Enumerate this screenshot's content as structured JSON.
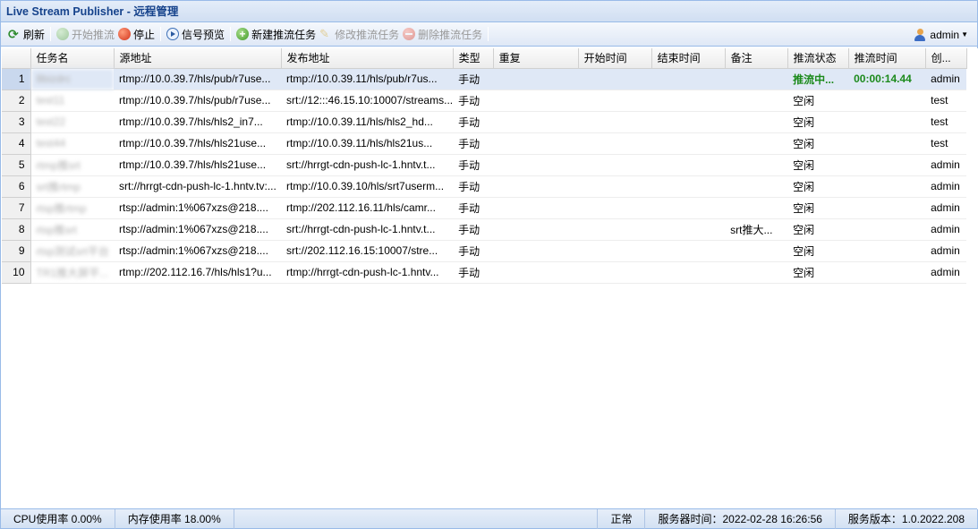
{
  "window": {
    "title": "Live Stream Publisher - 远程管理"
  },
  "toolbar": {
    "refresh": "刷新",
    "start": "开始推流",
    "stop": "停止",
    "preview": "信号预览",
    "new_task": "新建推流任务",
    "edit_task": "修改推流任务",
    "delete_task": "删除推流任务",
    "user": "admin"
  },
  "table": {
    "columns": [
      "",
      "任务名",
      "源地址",
      "发布地址",
      "类型",
      "重复",
      "开始时间",
      "结束时间",
      "备注",
      "推流状态",
      "推流时间",
      "创..."
    ],
    "rows": [
      {
        "num": "1",
        "name": "8bizdrc",
        "src": "rtmp://10.0.39.7/hls/pub/r7use...",
        "dst": "rtmp://10.0.39.11/hls/pub/r7us...",
        "type": "手动",
        "repeat": "",
        "start": "",
        "end": "",
        "note": "",
        "status": "推流中...",
        "time": "00:00:14.44",
        "creator": "admin"
      },
      {
        "num": "2",
        "name": "test11",
        "src": "rtmp://10.0.39.7/hls/pub/r7use...",
        "dst": "srt://12:::46.15.10:10007/streams...",
        "type": "手动",
        "repeat": "",
        "start": "",
        "end": "",
        "note": "",
        "status": "空闲",
        "time": "",
        "creator": "test"
      },
      {
        "num": "3",
        "name": "test22",
        "src": "rtmp://10.0.39.7/hls/hls2_in7...",
        "dst": "rtmp://10.0.39.11/hls/hls2_hd...",
        "type": "手动",
        "repeat": "",
        "start": "",
        "end": "",
        "note": "",
        "status": "空闲",
        "time": "",
        "creator": "test"
      },
      {
        "num": "4",
        "name": "test44",
        "src": "rtmp://10.0.39.7/hls/hls21use...",
        "dst": "rtmp://10.0.39.11/hls/hls21us...",
        "type": "手动",
        "repeat": "",
        "start": "",
        "end": "",
        "note": "",
        "status": "空闲",
        "time": "",
        "creator": "test"
      },
      {
        "num": "5",
        "name": "rtmp推srt",
        "src": "rtmp://10.0.39.7/hls/hls21use...",
        "dst": "srt://hrrgt-cdn-push-lc-1.hntv.t...",
        "type": "手动",
        "repeat": "",
        "start": "",
        "end": "",
        "note": "",
        "status": "空闲",
        "time": "",
        "creator": "admin"
      },
      {
        "num": "6",
        "name": "srt推rtmp",
        "src": "srt://hrrgt-cdn-push-lc-1.hntv.tv:...",
        "dst": "rtmp://10.0.39.10/hls/srt7userm...",
        "type": "手动",
        "repeat": "",
        "start": "",
        "end": "",
        "note": "",
        "status": "空闲",
        "time": "",
        "creator": "admin"
      },
      {
        "num": "7",
        "name": "rtsp推rtmp",
        "src": "rtsp://admin:1%067xzs@218....",
        "dst": "rtmp://202.112.16.11/hls/camr...",
        "type": "手动",
        "repeat": "",
        "start": "",
        "end": "",
        "note": "",
        "status": "空闲",
        "time": "",
        "creator": "admin"
      },
      {
        "num": "8",
        "name": "rtsp推srt",
        "src": "rtsp://admin:1%067xzs@218....",
        "dst": "srt://hrrgt-cdn-push-lc-1.hntv.t...",
        "type": "手动",
        "repeat": "",
        "start": "",
        "end": "",
        "note": "srt推大...",
        "status": "空闲",
        "time": "",
        "creator": "admin"
      },
      {
        "num": "9",
        "name": "rtsp测试srt平台",
        "src": "rtsp://admin:1%067xzs@218....",
        "dst": "srt://202.112.16.15:10007/stre...",
        "type": "手动",
        "repeat": "",
        "start": "",
        "end": "",
        "note": "",
        "status": "空闲",
        "time": "",
        "creator": "admin"
      },
      {
        "num": "10",
        "name": "TR1推大屏平...",
        "src": "rtmp://202.112.16.7/hls/hls1?u...",
        "dst": "rtmp://hrrgt-cdn-push-lc-1.hntv...",
        "type": "手动",
        "repeat": "",
        "start": "",
        "end": "",
        "note": "",
        "status": "空闲",
        "time": "",
        "creator": "admin"
      }
    ]
  },
  "statusbar": {
    "cpu": "CPU使用率 0.00%",
    "memory": "内存使用率 18.00%",
    "state": "正常",
    "server_time": "服务器时间：2022-02-28 16:26:56",
    "version": "服务版本：1.0.2022.208"
  },
  "colors": {
    "title": "#15428b",
    "active_status": "#1c8a1c",
    "selected_row": "#dfe8f6"
  }
}
